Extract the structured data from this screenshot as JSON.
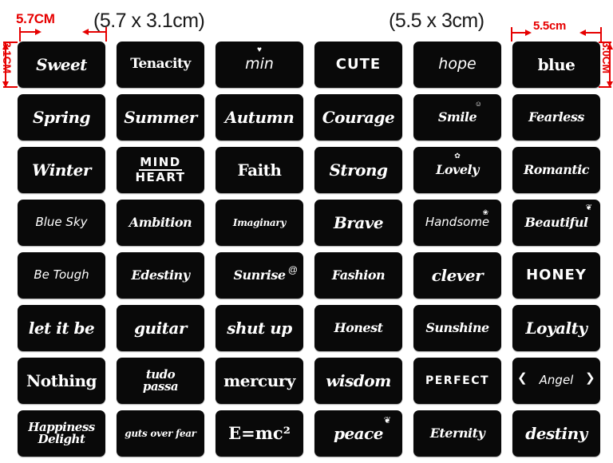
{
  "annotations": {
    "top_left_red": "5.7CM",
    "top_left_paren": "(5.7 x 3.1cm)",
    "top_right_paren": "(5.5 x 3cm)",
    "top_right_red": "5.5cm",
    "left_vertical_red": "3.1CM",
    "right_vertical_red": "3.0CM"
  },
  "grid": {
    "columns": 6,
    "rows": 8,
    "tiles": [
      {
        "label": "Sweet",
        "style": "f-script",
        "deco": ""
      },
      {
        "label": "Tenacity",
        "style": "f-goth-sm",
        "deco": ""
      },
      {
        "label": "min",
        "style": "f-hand",
        "deco": "heart-icon"
      },
      {
        "label": "CUTE",
        "style": "f-stencil",
        "deco": ""
      },
      {
        "label": "hope",
        "style": "f-hand",
        "deco": ""
      },
      {
        "label": "blue",
        "style": "f-goth",
        "deco": ""
      },
      {
        "label": "Spring",
        "style": "f-script",
        "deco": ""
      },
      {
        "label": "Summer",
        "style": "f-script",
        "deco": ""
      },
      {
        "label": "Autumn",
        "style": "f-script",
        "deco": ""
      },
      {
        "label": "Courage",
        "style": "f-script",
        "deco": ""
      },
      {
        "label": "Smile",
        "style": "f-script-sm",
        "deco": "smiley-icon"
      },
      {
        "label": "Fearless",
        "style": "f-script-sm",
        "deco": ""
      },
      {
        "label": "Winter",
        "style": "f-script",
        "deco": ""
      },
      {
        "label": "MIND|HEART",
        "style": "f-stencil-sm",
        "deco": "rule"
      },
      {
        "label": "Faith",
        "style": "f-goth",
        "deco": ""
      },
      {
        "label": "Strong",
        "style": "f-script",
        "deco": ""
      },
      {
        "label": "Lovely",
        "style": "f-script-sm",
        "deco": "paw-icon"
      },
      {
        "label": "Romantic",
        "style": "f-script-sm",
        "deco": ""
      },
      {
        "label": "Blue Sky",
        "style": "f-hand-sm",
        "deco": ""
      },
      {
        "label": "Ambition",
        "style": "f-script-sm",
        "deco": ""
      },
      {
        "label": "Imaginary",
        "style": "f-script-xs",
        "deco": ""
      },
      {
        "label": "Brave",
        "style": "f-script",
        "deco": ""
      },
      {
        "label": "Handsome",
        "style": "f-hand-sm",
        "deco": "leaf-icon"
      },
      {
        "label": "Beautiful",
        "style": "f-script-sm",
        "deco": "butterfly-icon"
      },
      {
        "label": "Be Tough",
        "style": "f-hand-sm",
        "deco": ""
      },
      {
        "label": "Edestiny",
        "style": "f-script-sm",
        "deco": ""
      },
      {
        "label": "Sunrise",
        "style": "f-script-sm",
        "deco": "spiral-icon"
      },
      {
        "label": "Fashion",
        "style": "f-script-sm",
        "deco": ""
      },
      {
        "label": "clever",
        "style": "f-script",
        "deco": ""
      },
      {
        "label": "HONEY",
        "style": "f-stencil",
        "deco": "heart-dot-icon"
      },
      {
        "label": "let it be",
        "style": "f-script",
        "deco": ""
      },
      {
        "label": "guitar",
        "style": "f-script",
        "deco": ""
      },
      {
        "label": "shut up",
        "style": "f-script",
        "deco": ""
      },
      {
        "label": "Honest",
        "style": "f-script-sm",
        "deco": ""
      },
      {
        "label": "Sunshine",
        "style": "f-script-sm",
        "deco": ""
      },
      {
        "label": "Loyalty",
        "style": "f-script",
        "deco": ""
      },
      {
        "label": "Nothing",
        "style": "f-goth",
        "deco": ""
      },
      {
        "label": "tudo|passa",
        "style": "f-script-sm",
        "deco": ""
      },
      {
        "label": "mercury",
        "style": "f-goth",
        "deco": ""
      },
      {
        "label": "wisdom",
        "style": "f-script",
        "deco": ""
      },
      {
        "label": "PERFECT",
        "style": "f-stencil-sm",
        "deco": ""
      },
      {
        "label": "Angel",
        "style": "f-hand-sm",
        "deco": "wings-icon"
      },
      {
        "label": "Happiness|Delight",
        "style": "f-script-sm",
        "deco": ""
      },
      {
        "label": "guts over fear",
        "style": "f-script-xs",
        "deco": ""
      },
      {
        "label": "E=mc²",
        "style": "f-serif",
        "deco": ""
      },
      {
        "label": "peace",
        "style": "f-script",
        "deco": "dove-icon"
      },
      {
        "label": "Eternity",
        "style": "f-script-sm",
        "deco": ""
      },
      {
        "label": "destiny",
        "style": "f-script",
        "deco": ""
      }
    ]
  },
  "colors": {
    "tile_bg": "#090909",
    "tile_text": "#ffffff",
    "annotation_red": "#e60000",
    "page_bg": "#ffffff"
  }
}
